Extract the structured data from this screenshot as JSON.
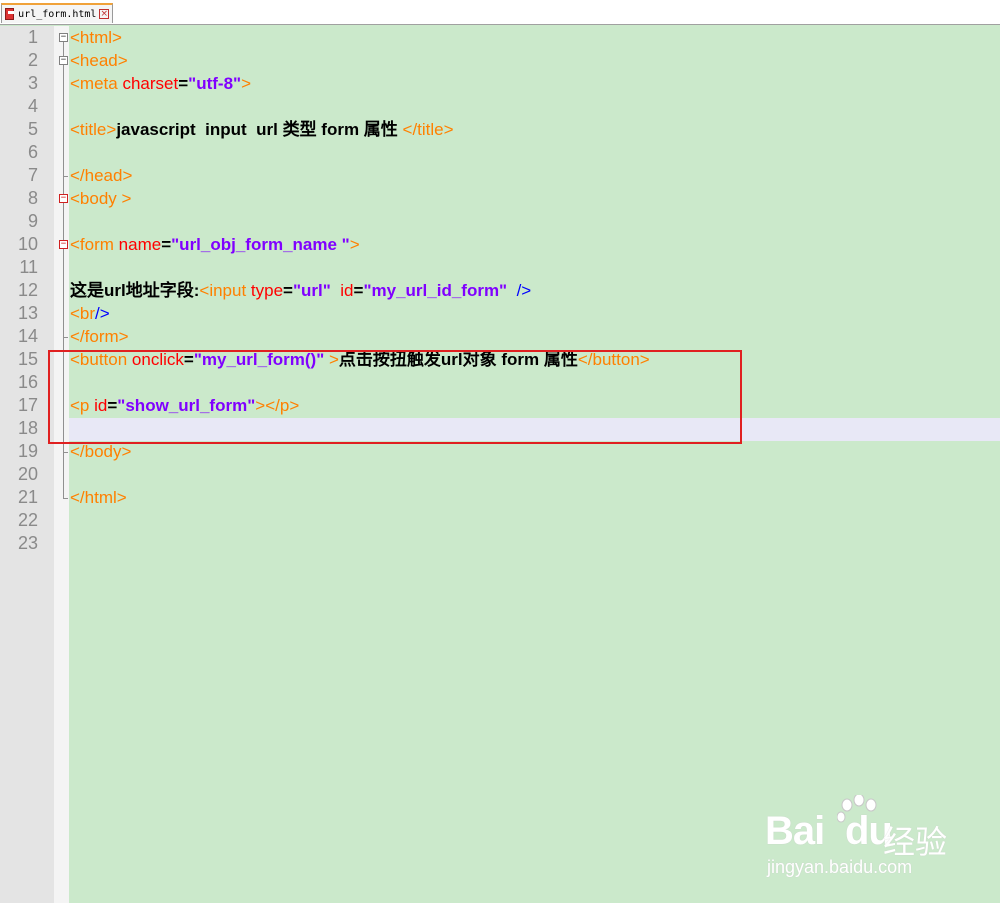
{
  "tab": {
    "filename": "url_form.html"
  },
  "line_numbers": [
    "1",
    "2",
    "3",
    "4",
    "5",
    "6",
    "7",
    "8",
    "9",
    "10",
    "11",
    "12",
    "13",
    "14",
    "15",
    "16",
    "17",
    "18",
    "19",
    "20",
    "21",
    "22",
    "23"
  ],
  "code": {
    "l1": [
      "<html>"
    ],
    "l2": [
      "<head>"
    ],
    "l3": [
      "<meta",
      " charset",
      "=",
      "\"utf-8\"",
      ">"
    ],
    "l5": [
      "<title>",
      "javascript  input  url 类型 form 属性 ",
      "</title>"
    ],
    "l7": [
      "</head>"
    ],
    "l8": [
      "<body >"
    ],
    "l10": [
      "<form",
      " name",
      "=",
      "\"url_obj_form_name \"",
      ">"
    ],
    "l12": [
      "这是url地址字段:",
      "<input",
      " type",
      "=",
      "\"url\"",
      "  id",
      "=",
      "\"my_url_id_form\"",
      "  />"
    ],
    "l13": [
      "<br",
      "/>"
    ],
    "l14": [
      "</form>"
    ],
    "l15": [
      "<button",
      " onclick",
      "=",
      "\"my_url_form()\"",
      " >",
      "点击按扭触发url对象 form 属性",
      "</button>"
    ],
    "l17": [
      "<p",
      " id",
      "=",
      "\"show_url_form\"",
      "></p>"
    ],
    "l19": [
      "</body>"
    ],
    "l21": [
      "</html>"
    ]
  },
  "watermark": {
    "brand": "Bai",
    "brand2": "du",
    "cn": "经验",
    "url": "jingyan.baidu.com"
  },
  "colors": {
    "tag": "#ff8000",
    "attribute": "#ff0000",
    "string": "#8000ff",
    "background": "#cbe9cb",
    "highlight_box": "#e02020"
  }
}
